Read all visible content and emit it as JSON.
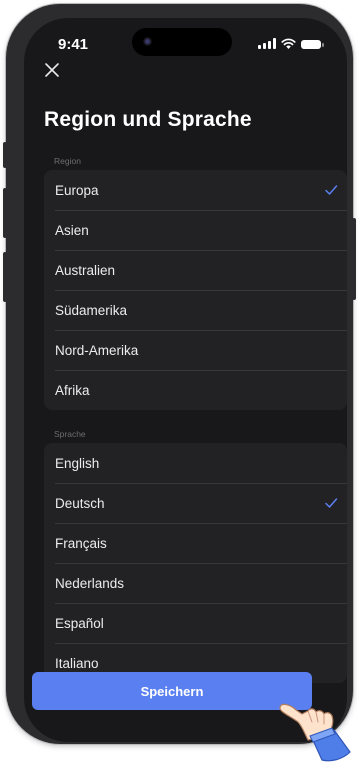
{
  "status_bar": {
    "time": "9:41"
  },
  "page": {
    "title": "Region und Sprache",
    "close_icon": "close-icon"
  },
  "region": {
    "label": "Region",
    "items": [
      {
        "label": "Europa",
        "selected": true
      },
      {
        "label": "Asien",
        "selected": false
      },
      {
        "label": "Australien",
        "selected": false
      },
      {
        "label": "Südamerika",
        "selected": false
      },
      {
        "label": "Nord-Amerika",
        "selected": false
      },
      {
        "label": "Afrika",
        "selected": false
      }
    ]
  },
  "language": {
    "label": "Sprache",
    "items": [
      {
        "label": "English",
        "selected": false
      },
      {
        "label": "Deutsch",
        "selected": true
      },
      {
        "label": "Français",
        "selected": false
      },
      {
        "label": "Nederlands",
        "selected": false
      },
      {
        "label": "Español",
        "selected": false
      },
      {
        "label": "Italiano",
        "selected": false
      }
    ]
  },
  "footer": {
    "save_label": "Speichern"
  },
  "colors": {
    "accent": "#5a7ff0",
    "background": "#18181a",
    "card": "#222224",
    "check": "#5a7ff0"
  }
}
